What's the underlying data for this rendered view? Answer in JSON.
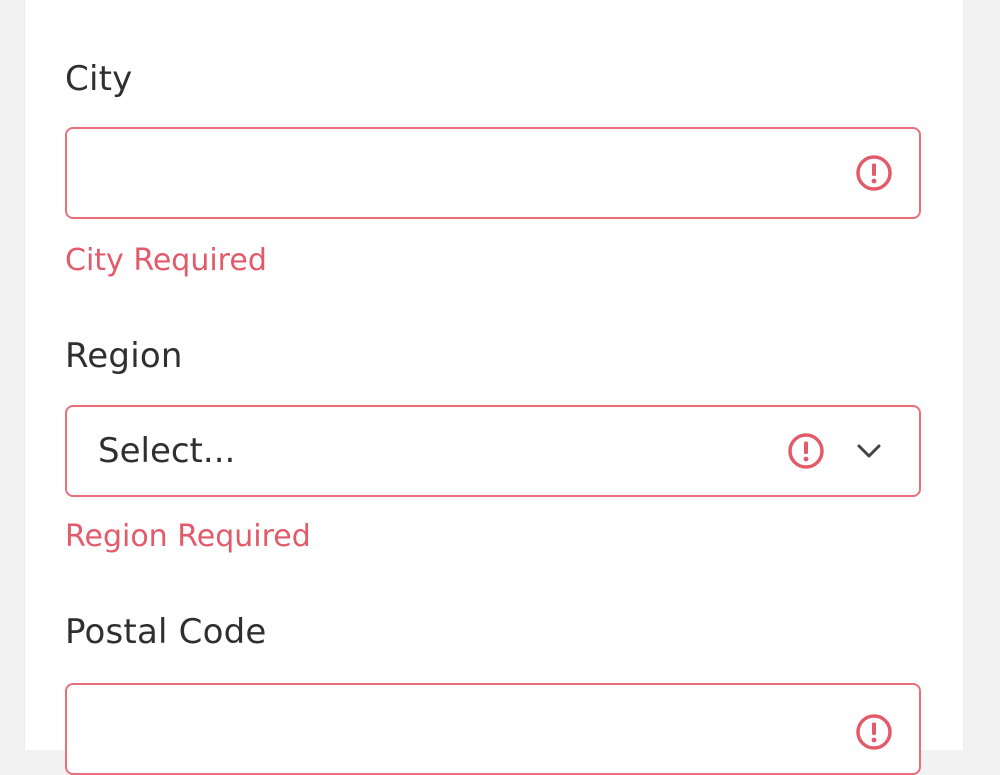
{
  "form": {
    "city": {
      "label": "City",
      "value": "",
      "error": "City Required"
    },
    "region": {
      "label": "Region",
      "placeholder": "Select...",
      "error": "Region Required"
    },
    "postal_code": {
      "label": "Postal Code",
      "value": ""
    }
  },
  "icons": {
    "error": "exclamation-circle-icon",
    "dropdown": "chevron-down-icon"
  },
  "colors": {
    "error": "#e35b6a",
    "error_border": "#e8707c",
    "label_text": "#2f2f2f",
    "background": "#f2f2f2",
    "panel": "#ffffff"
  }
}
